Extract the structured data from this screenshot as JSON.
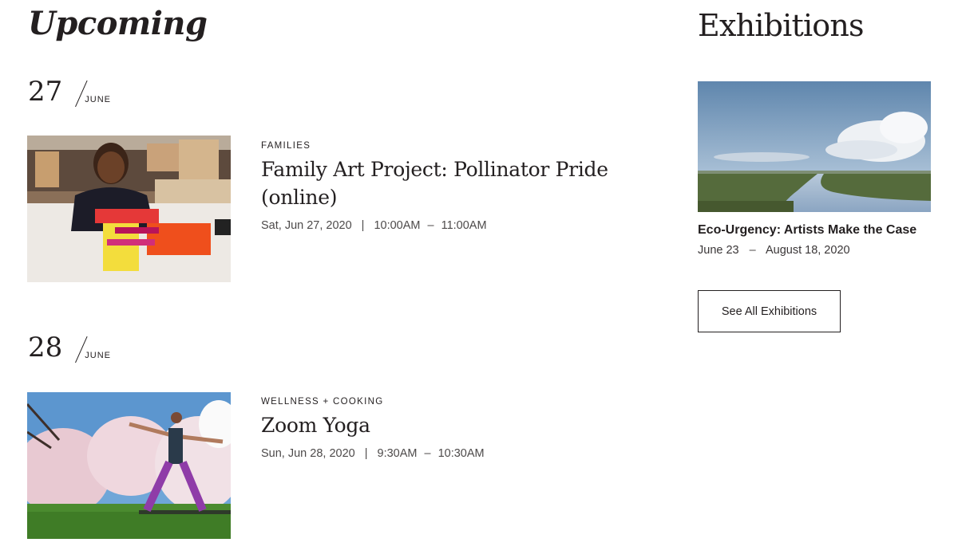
{
  "upcoming": {
    "heading": "Upcoming",
    "days": [
      {
        "day": "27",
        "month": "JUNE",
        "event": {
          "category": "FAMILIES",
          "title": "Family Art Project: Pollinator Pride (online)",
          "date": "Sat, Jun 27, 2020",
          "start": "10:00AM",
          "end": "11:00AM"
        }
      },
      {
        "day": "28",
        "month": "JUNE",
        "event": {
          "category": "WELLNESS + COOKING",
          "title": "Zoom Yoga",
          "date": "Sun, Jun 28, 2020",
          "start": "9:30AM",
          "end": "10:30AM"
        }
      }
    ],
    "separator": "|",
    "dash": "–"
  },
  "exhibitions": {
    "heading": "Exhibitions",
    "featured": {
      "title": "Eco-Urgency: Artists Make the Case",
      "start": "June 23",
      "end": "August 18, 2020",
      "dash": "–"
    },
    "see_all_label": "See All Exhibitions"
  },
  "colors": {
    "text": "#231f20",
    "meta": "#4d4a4a",
    "background": "#ffffff"
  }
}
